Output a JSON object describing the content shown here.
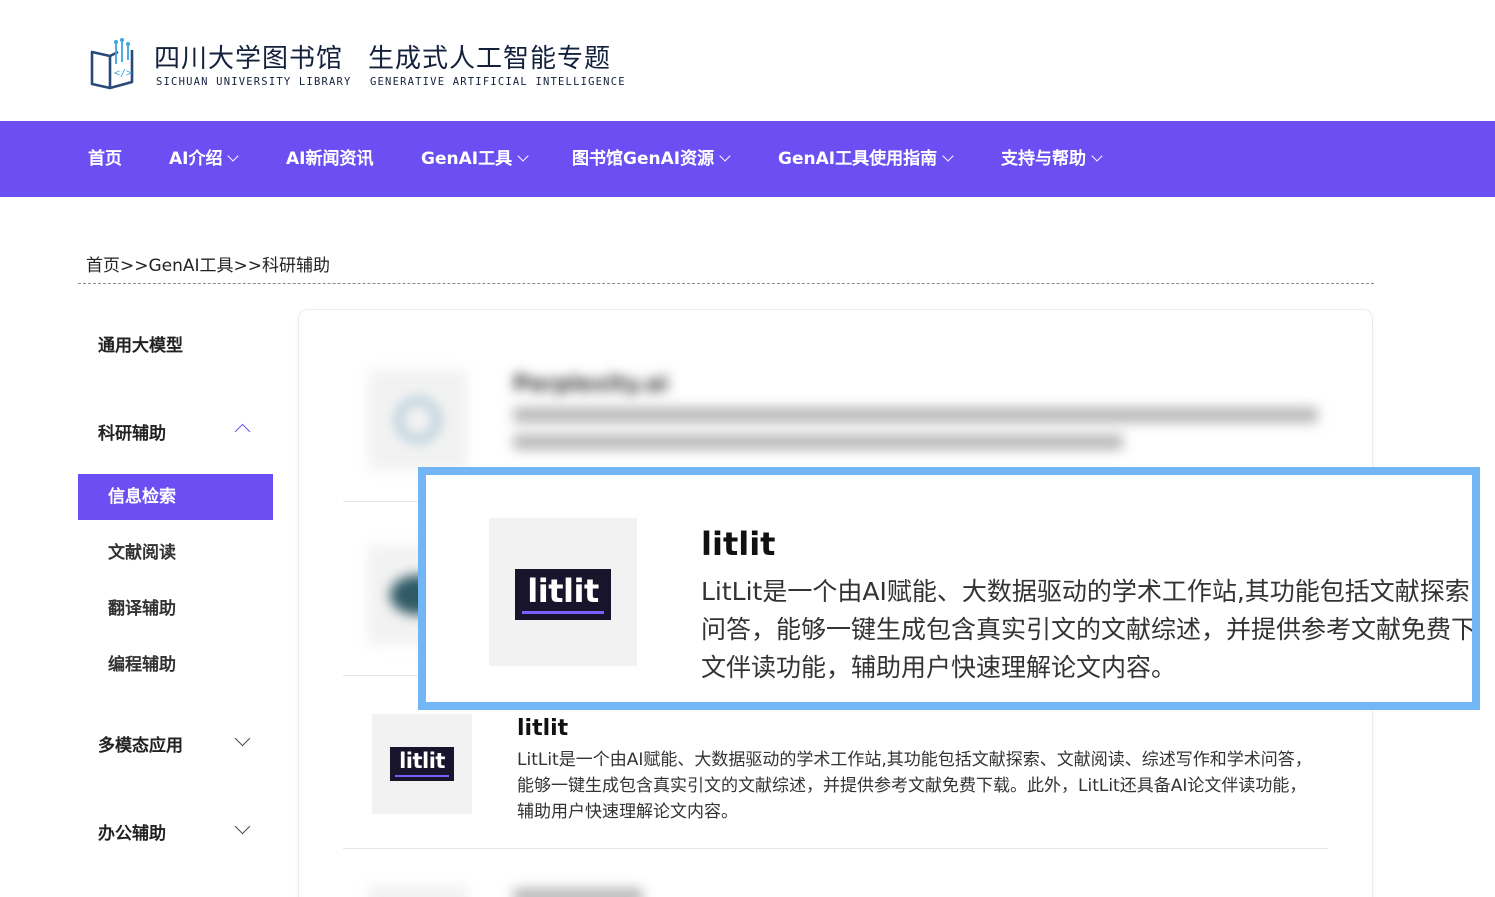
{
  "header": {
    "library_cn": "四川大学图书馆",
    "library_en": "SICHUAN UNIVERSITY LIBRARY",
    "topic_cn": "生成式人工智能专题",
    "topic_en": "GENERATIVE ARTIFICIAL INTELLIGENCE",
    "logo_icon": "book-circuit-icon"
  },
  "nav": {
    "items": [
      {
        "label": "首页",
        "dropdown": false
      },
      {
        "label": "AI介绍",
        "dropdown": true
      },
      {
        "label": "AI新闻资讯",
        "dropdown": false
      },
      {
        "label": "GenAI工具",
        "dropdown": true
      },
      {
        "label": "图书馆GenAI资源",
        "dropdown": true
      },
      {
        "label": "GenAI工具使用指南",
        "dropdown": true
      },
      {
        "label": "支持与帮助",
        "dropdown": true
      }
    ]
  },
  "breadcrumb": "首页>>GenAI工具>>科研辅助",
  "sidebar": {
    "groups": [
      {
        "label": "通用大模型"
      },
      {
        "label": "科研辅助",
        "expanded": true
      },
      {
        "label": "多模态应用",
        "expanded": false
      },
      {
        "label": "办公辅助",
        "expanded": false
      }
    ],
    "subitems": [
      {
        "label": "信息检索",
        "active": true
      },
      {
        "label": "文献阅读"
      },
      {
        "label": "翻译辅助"
      },
      {
        "label": "编程辅助"
      }
    ]
  },
  "tools": {
    "blurred_first_title": "Perplexity.ai",
    "litlit": {
      "title": "litlit",
      "logo_text": "litlit",
      "description": "LitLit是一个由AI赋能、大数据驱动的学术工作站,其功能包括文献探索、文献阅读、综述写作和学术问答，能够一键生成包含真实引文的文献综述，并提供参考文献免费下载。此外，LitLit还具备AI论文伴读功能，辅助用户快速理解论文内容。",
      "zoom_desc_lines": [
        "LitLit是一个由AI赋能、大数据驱动的学术工作站,其功能包括文献探索",
        "问答，能够一键生成包含真实引文的文献综述，并提供参考文献免费下载",
        "文伴读功能，辅助用户快速理解论文内容。"
      ]
    }
  },
  "colors": {
    "accent": "#6c4ff2",
    "callout_border": "#72b6f5",
    "logo_bg": "#17142b"
  }
}
